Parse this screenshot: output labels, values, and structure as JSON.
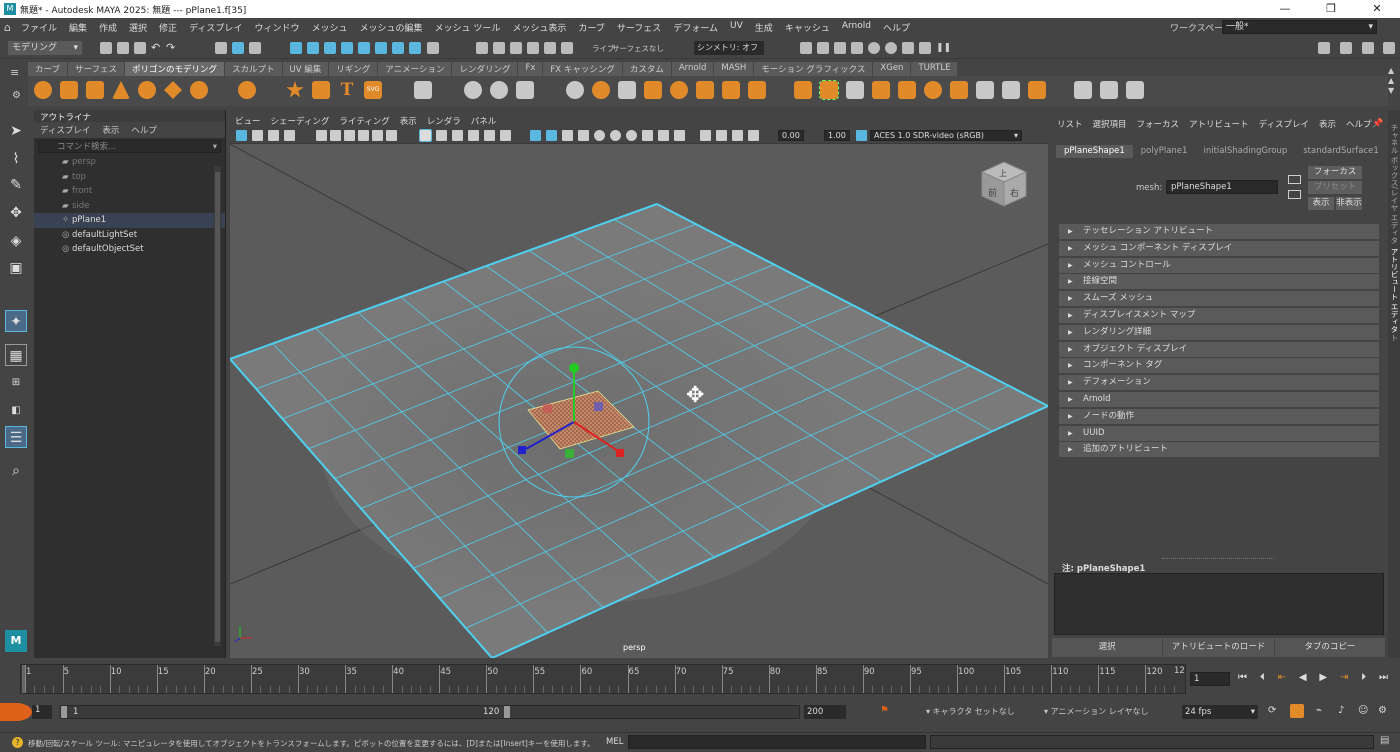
{
  "window": {
    "title": "無題* - Autodesk MAYA 2025: 無題   ---   pPlane1.f[35]",
    "min": "—",
    "max": "❐",
    "close": "✕"
  },
  "menubar": {
    "items": [
      "ファイル",
      "編集",
      "作成",
      "選択",
      "修正",
      "ディスプレイ",
      "ウィンドウ",
      "メッシュ",
      "メッシュの編集",
      "メッシュ ツール",
      "メッシュ表示",
      "カーブ",
      "サーフェス",
      "デフォーム",
      "UV",
      "生成",
      "キャッシュ",
      "Arnold",
      "ヘルプ"
    ],
    "workspace_label": "ワークスペース:",
    "workspace_value": "一般*"
  },
  "statusline": {
    "mode": "モデリング",
    "live_label": "ライブ",
    "live_value": "サーフェスなし",
    "symmetry": "シンメトリ: オフ"
  },
  "shelf": {
    "tabs": [
      "カーブ",
      "サーフェス",
      "ポリゴンのモデリング",
      "スカルプト",
      "UV 編集",
      "リギング",
      "アニメーション",
      "レンダリング",
      "Fx",
      "FX キャッシング",
      "カスタム",
      "Arnold",
      "MASH",
      "モーション グラフィックス",
      "XGen",
      "TURTLE"
    ],
    "active": "ポリゴンのモデリング"
  },
  "outliner": {
    "title": "アウトライナ",
    "menu": [
      "ディスプレイ",
      "表示",
      "ヘルプ"
    ],
    "search_placeholder": "コマンド検索...",
    "rows": [
      {
        "label": "persp",
        "icon": "▰",
        "dim": true
      },
      {
        "label": "top",
        "icon": "▰",
        "dim": true
      },
      {
        "label": "front",
        "icon": "▰",
        "dim": true
      },
      {
        "label": "side",
        "icon": "▰",
        "dim": true
      },
      {
        "label": "pPlane1",
        "icon": "✧",
        "dim": false,
        "selected": true
      },
      {
        "label": "defaultLightSet",
        "icon": "◎",
        "dim": false
      },
      {
        "label": "defaultObjectSet",
        "icon": "◎",
        "dim": false
      }
    ]
  },
  "viewport": {
    "menu": [
      "ビュー",
      "シェーディング",
      "ライティング",
      "表示",
      "レンダラ",
      "パネル"
    ],
    "near": "0.00",
    "far": "1.00",
    "colorspace": "ACES 1.0 SDR-video (sRGB)",
    "camera_label": "persp",
    "viewcube": {
      "top": "上",
      "front": "前",
      "right": "右"
    }
  },
  "attribute_editor": {
    "menu": [
      "リスト",
      "選択項目",
      "フォーカス",
      "アトリビュート",
      "ディスプレイ",
      "表示",
      "ヘルプ"
    ],
    "tabs": [
      "pPlaneShape1",
      "polyPlane1",
      "initialShadingGroup",
      "standardSurface1"
    ],
    "active_tab": "pPlaneShape1",
    "mesh_label": "mesh:",
    "mesh_value": "pPlaneShape1",
    "focus_btn": "フォーカス",
    "preset_btn": "プリセット",
    "show_btn": "表示",
    "hide_btn": "非表示",
    "frames": [
      "テッセレーション アトリビュート",
      "メッシュ コンポーネント ディスプレイ",
      "メッシュ コントロール",
      "接線空間",
      "スムーズ メッシュ",
      "ディスプレイスメント マップ",
      "レンダリング詳細",
      "オブジェクト ディスプレイ",
      "コンポーネント タグ",
      "デフォメーション",
      "Arnold",
      "ノードの動作",
      "UUID",
      "追加のアトリビュート"
    ],
    "notes_label": "注:  pPlaneShape1",
    "bottom_buttons": [
      "選択",
      "アトリビュートのロード",
      "タブのコピー"
    ],
    "side_tabs": [
      "チャネル ボックス/レイヤ エディタ",
      "アトリビュート エディタ",
      "モデリング ツールキット"
    ]
  },
  "timeline": {
    "ticks": [
      1,
      5,
      10,
      15,
      20,
      25,
      30,
      35,
      40,
      45,
      50,
      55,
      60,
      65,
      70,
      75,
      80,
      85,
      90,
      95,
      100,
      105,
      110,
      115,
      120
    ],
    "current_frame": "1",
    "last_label": "12"
  },
  "range": {
    "start": "1",
    "inner_start": "1",
    "inner_end": "120",
    "end": "200",
    "character_set": "キャラクタ セットなし",
    "anim_layer": "アニメーション レイヤなし",
    "fps": "24 fps"
  },
  "help": {
    "text": "移動/回転/スケール ツール: マニピュレータを使用してオブジェクトをトランスフォームします。ピボットの位置を変更するには、[D]または[Insert]キーを使用します。",
    "mel_label": "MEL"
  },
  "colors": {
    "wire": "#4fd0f0",
    "accent": "#e08a2a",
    "selection": "#394252"
  }
}
